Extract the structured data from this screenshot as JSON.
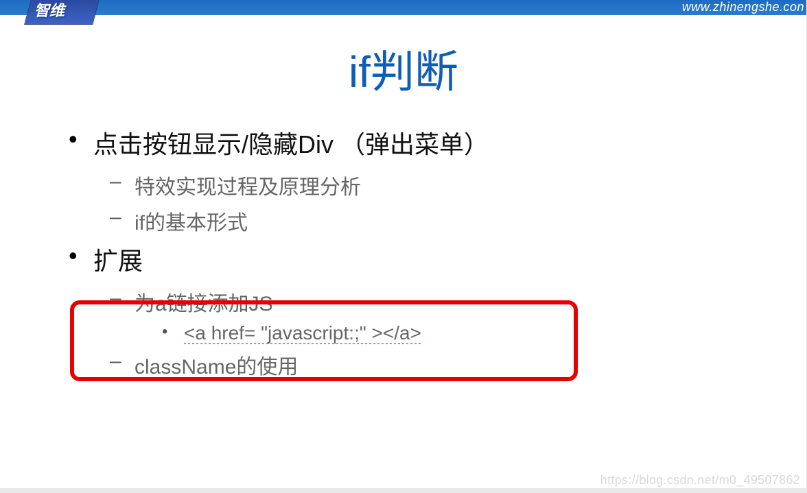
{
  "header": {
    "logo_text": "智维",
    "url": "www.zhinengshe.con"
  },
  "title": "if判断",
  "bullets": {
    "b1": "点击按钮显示/隐藏Div （弹出菜单）",
    "b1_1": "特效实现过程及原理分析",
    "b1_2": "if的基本形式",
    "b2": "扩展",
    "b2_1": "为a链接添加JS",
    "b2_1_1": "<a href= \"javascript:;\" ></a>",
    "b2_2": "className的使用"
  },
  "watermark": "https://blog.csdn.net/m0_49507862"
}
